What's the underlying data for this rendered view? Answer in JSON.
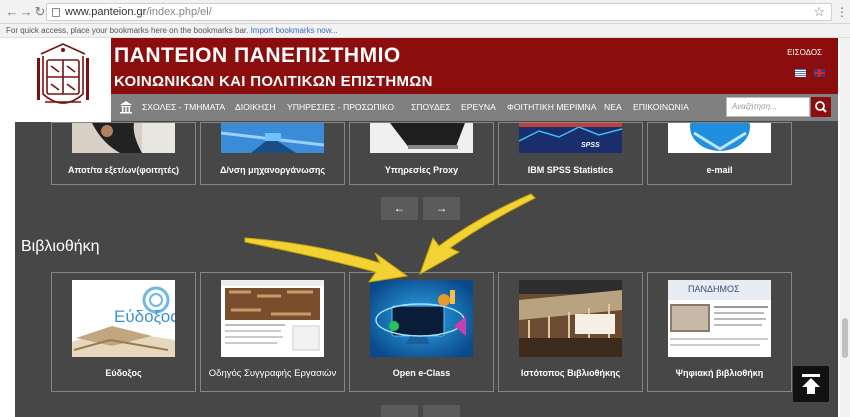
{
  "browser": {
    "url_host": "www.panteion.gr",
    "url_path": "/index.php/el/",
    "bookmark_hint": "For quick access, place your bookmarks here on the bookmarks bar.",
    "bookmark_import": "Import bookmarks now..."
  },
  "header": {
    "title_line1": "ΠΑΝΤΕΙΟΝ ΠΑΝΕΠΙΣΤΗΜΙΟ",
    "title_line2": "ΚΟΙΝΩΝΙΚΩΝ ΚΑΙ ΠΟΛΙΤΙΚΩΝ ΕΠΙΣΤΗΜΩΝ",
    "login": "ΕΙΣΟΔΟΣ"
  },
  "menu": {
    "items": [
      "ΣΧΟΛΕΣ - ΤΜΗΜΑΤΑ",
      "ΔΙΟΙΚΗΣΗ",
      "ΥΠΗΡΕΣΙΕΣ - ΠΡΟΣΩΠΙΚΟ",
      "ΣΠΟΥΔΕΣ",
      "ΕΡΕΥΝΑ",
      "ΦΟΙΤΗΤΙΚΗ ΜΕΡΙΜΝΑ",
      "ΝΕΑ",
      "ΕΠΙΚΟΙΝΩΝΙΑ"
    ],
    "search_placeholder": "Αναζήτηση..."
  },
  "services": {
    "tiles": [
      {
        "label": "Αποτ/τα εξετ/ων(φοιτητές)"
      },
      {
        "label": "Δ/νση μηχανοργάνωσης"
      },
      {
        "label": "Υπηρεσίες Proxy"
      },
      {
        "label": "IBM SPSS Statistics",
        "image_text": "SPSS"
      },
      {
        "label": "e-mail"
      }
    ],
    "prev": "←",
    "next": "→"
  },
  "library": {
    "title": "Βιβλιοθήκη",
    "tiles": [
      {
        "label": "Εύδοξος",
        "image_text": "Εύδοξος"
      },
      {
        "label": "Οδηγός Συγγραφής Εργασιών"
      },
      {
        "label": "Open e-Class"
      },
      {
        "label": "Ιστότοπος Βιβλιοθήκης"
      },
      {
        "label": "Ψηφιακή βιβλιοθήκη",
        "image_text": "ΠΑΝΔΗΜΟΣ"
      }
    ]
  },
  "colors": {
    "brand": "#8b0d0d",
    "menu": "#808080",
    "body": "#474747",
    "arrow": "#f2d234"
  },
  "icons": [
    "home-icon",
    "search-icon",
    "back-to-top-icon",
    "star-icon"
  ]
}
